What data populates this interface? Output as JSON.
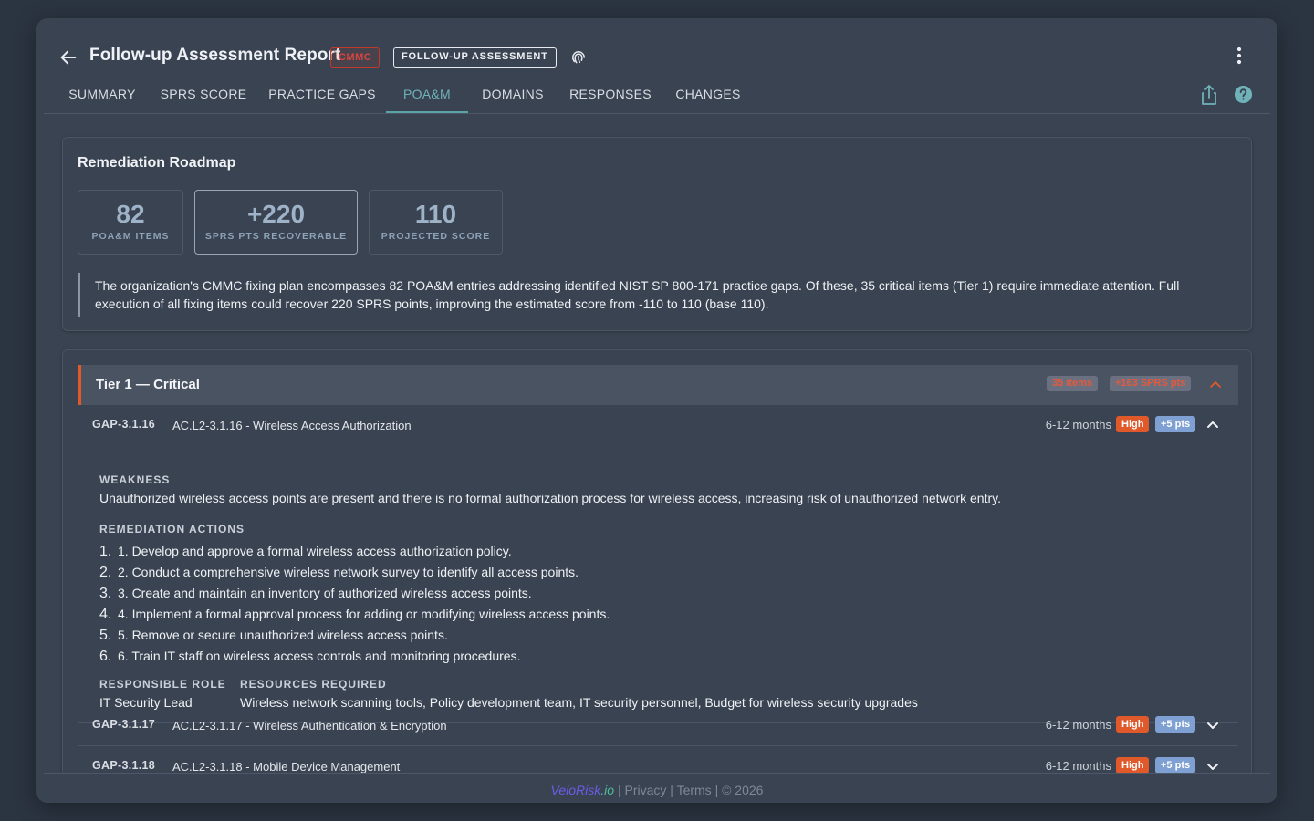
{
  "header": {
    "title": "Follow-up Assessment Report",
    "badge_framework": "CMMC",
    "badge_type": "FOLLOW-UP ASSESSMENT"
  },
  "tabs": [
    {
      "label": "SUMMARY"
    },
    {
      "label": "SPRS SCORE"
    },
    {
      "label": "PRACTICE GAPS"
    },
    {
      "label": "POA&M"
    },
    {
      "label": "DOMAINS"
    },
    {
      "label": "RESPONSES"
    },
    {
      "label": "CHANGES"
    }
  ],
  "active_tab": "POA&M",
  "roadmap": {
    "title": "Remediation Roadmap",
    "stats": [
      {
        "value": "82",
        "label": "POA&M ITEMS"
      },
      {
        "value": "+220",
        "label": "SPRS PTS RECOVERABLE"
      },
      {
        "value": "110",
        "label": "PROJECTED SCORE"
      }
    ],
    "summary_line1": "The organization's CMMC fixing plan encompasses 82 POA&M entries addressing identified NIST SP 800-171 practice gaps. Of these, 35 critical items (Tier 1) require immediate attention. Full",
    "summary_line2": "execution of all fixing items could recover 220 SPRS points, improving the estimated score from -110 to 110 (base 110)."
  },
  "tier1": {
    "title": "Tier 1 — Critical",
    "items_chip": "35 items",
    "pts_chip": "+163 SPRS pts",
    "gaps": [
      {
        "id": "GAP-3.1.16",
        "name": "AC.L2-3.1.16 - Wireless Access Authorization",
        "timeframe": "6-12 months",
        "priority": "High",
        "points": "+5 pts",
        "weakness_label": "WEAKNESS",
        "weakness": "Unauthorized wireless access points are present and there is no formal authorization process for wireless access, increasing risk of unauthorized network entry.",
        "actions_label": "REMEDIATION ACTIONS",
        "actions": [
          {
            "num": "1.",
            "text": "1. Develop and approve a formal wireless access authorization policy."
          },
          {
            "num": "2.",
            "text": "2. Conduct a comprehensive wireless network survey to identify all access points."
          },
          {
            "num": "3.",
            "text": "3. Create and maintain an inventory of authorized wireless access points."
          },
          {
            "num": "4.",
            "text": "4. Implement a formal approval process for adding or modifying wireless access points."
          },
          {
            "num": "5.",
            "text": "5. Remove or secure unauthorized wireless access points."
          },
          {
            "num": "6.",
            "text": "6. Train IT staff on wireless access controls and monitoring procedures."
          }
        ],
        "role_label": "RESPONSIBLE ROLE",
        "role": "IT Security Lead",
        "resources_label": "RESOURCES REQUIRED",
        "resources": "Wireless network scanning tools, Policy development team, IT security personnel, Budget for wireless security upgrades"
      },
      {
        "id": "GAP-3.1.17",
        "name": "AC.L2-3.1.17 - Wireless Authentication & Encryption",
        "timeframe": "6-12 months",
        "priority": "High",
        "points": "+5 pts"
      },
      {
        "id": "GAP-3.1.18",
        "name": "AC.L2-3.1.18 - Mobile Device Management",
        "timeframe": "6-12 months",
        "priority": "High",
        "points": "+5 pts"
      }
    ]
  },
  "footer": {
    "brand_a": "VeloRisk",
    "brand_b": ".io",
    "sep1": " | ",
    "privacy": "Privacy",
    "sep2": " | ",
    "terms": "Terms",
    "copyright": " | © 2026"
  },
  "colors": {
    "accent": "#5aa3a8",
    "critical": "#e0592b",
    "points": "#7ea0d2",
    "framework_badge": "#c0392b"
  }
}
